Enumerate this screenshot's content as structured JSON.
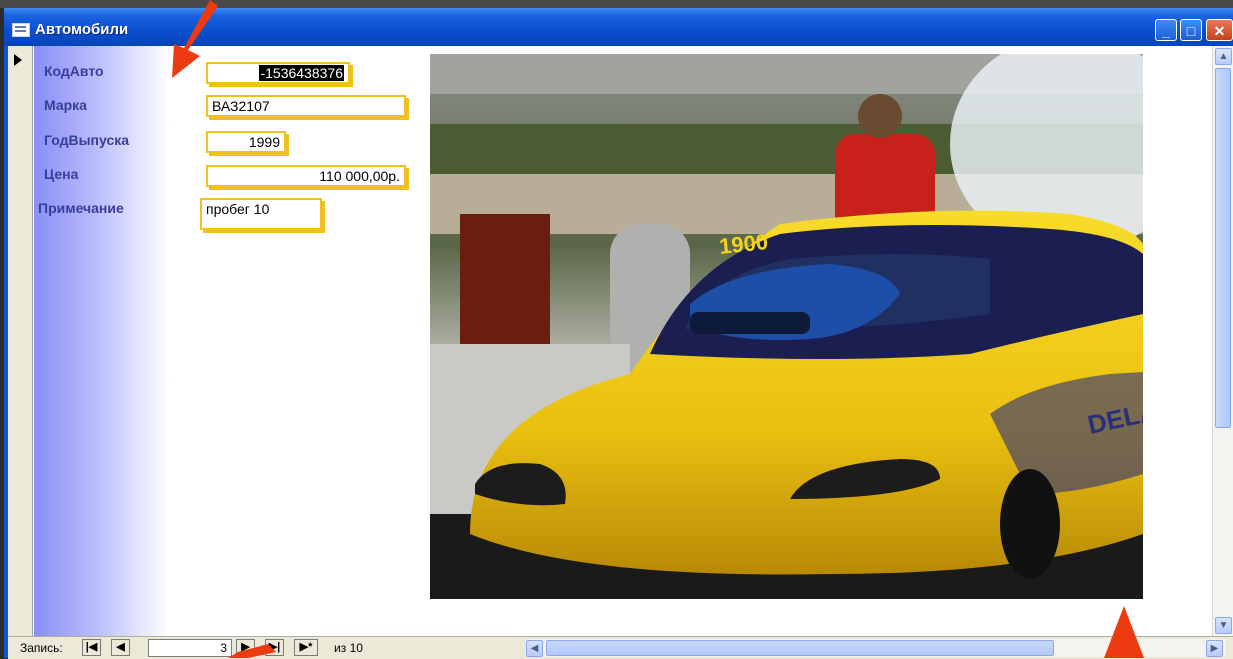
{
  "window": {
    "title": "Автомобили"
  },
  "form": {
    "fields": [
      {
        "label": "КодАвто",
        "value": "-1536438376"
      },
      {
        "label": "Марка",
        "value": "ВАЗ2107"
      },
      {
        "label": "ГодВыпуска",
        "value": "1999"
      },
      {
        "label": "Цена",
        "value": "110 000,00р."
      },
      {
        "label": "Примечание",
        "value": "пробег 10"
      }
    ]
  },
  "navigation": {
    "record_label": "Запись:",
    "current_record": "3",
    "of_label": "из",
    "total_records": "10",
    "new_record_symbol": "▶*"
  },
  "colors": {
    "accent": "#0a5ad8",
    "field_border": "#f0c020",
    "label_text": "#3a3e9a"
  },
  "icons": [
    "form-icon",
    "minimize-icon",
    "maximize-icon",
    "close-icon",
    "first-record-icon",
    "prev-record-icon",
    "next-record-icon",
    "last-record-icon",
    "new-record-icon"
  ]
}
